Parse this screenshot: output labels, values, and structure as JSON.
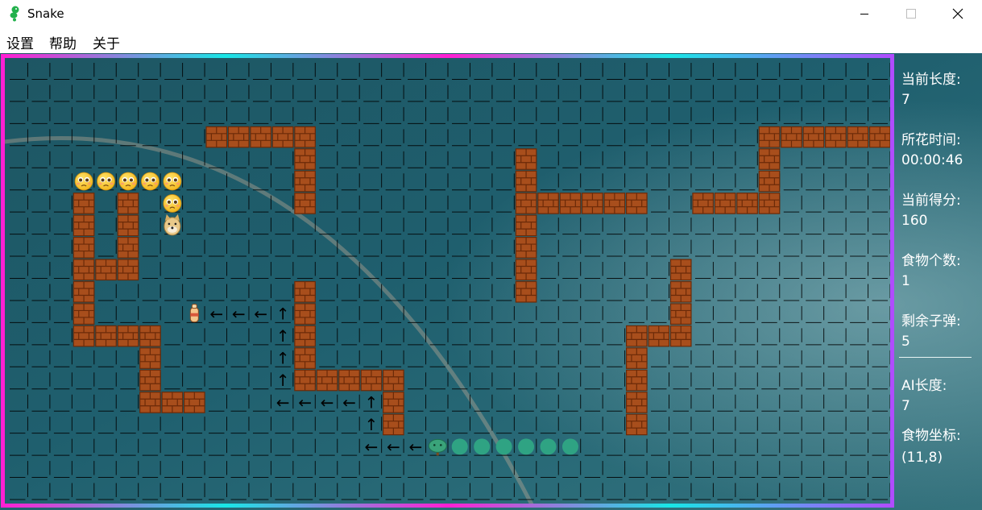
{
  "window": {
    "title": "Snake",
    "icon": "green-snake-icon"
  },
  "menu": {
    "items": [
      "设置",
      "帮助",
      "关于"
    ]
  },
  "panel": {
    "current_length_label": "当前长度:",
    "current_length_value": "7",
    "time_label": "所花时间:",
    "time_value": "00:00:46",
    "score_label": "当前得分:",
    "score_value": "160",
    "food_count_label": "食物个数:",
    "food_count_value": "1",
    "bullets_label": "剩余子弹:",
    "bullets_value": "5",
    "ai_length_label": "AI长度:",
    "ai_length_value": "7",
    "food_coord_label": "食物坐标:",
    "food_coord_value": "(11,8)"
  },
  "board": {
    "columns": 40,
    "rows": 20,
    "walls": [
      [
        9,
        3
      ],
      [
        10,
        3
      ],
      [
        11,
        3
      ],
      [
        12,
        3
      ],
      [
        13,
        3
      ],
      [
        13,
        4
      ],
      [
        13,
        5
      ],
      [
        13,
        6
      ],
      [
        3,
        6
      ],
      [
        3,
        7
      ],
      [
        3,
        8
      ],
      [
        3,
        9
      ],
      [
        3,
        10
      ],
      [
        3,
        11
      ],
      [
        3,
        12
      ],
      [
        5,
        6
      ],
      [
        5,
        7
      ],
      [
        5,
        8
      ],
      [
        5,
        9
      ],
      [
        4,
        9
      ],
      [
        4,
        12
      ],
      [
        5,
        12
      ],
      [
        6,
        12
      ],
      [
        6,
        13
      ],
      [
        6,
        14
      ],
      [
        6,
        15
      ],
      [
        7,
        15
      ],
      [
        8,
        15
      ],
      [
        13,
        10
      ],
      [
        13,
        11
      ],
      [
        13,
        12
      ],
      [
        13,
        13
      ],
      [
        13,
        14
      ],
      [
        14,
        14
      ],
      [
        15,
        14
      ],
      [
        16,
        14
      ],
      [
        17,
        14
      ],
      [
        17,
        15
      ],
      [
        17,
        16
      ],
      [
        23,
        4
      ],
      [
        23,
        5
      ],
      [
        23,
        6
      ],
      [
        23,
        7
      ],
      [
        23,
        8
      ],
      [
        23,
        9
      ],
      [
        23,
        10
      ],
      [
        24,
        6
      ],
      [
        25,
        6
      ],
      [
        26,
        6
      ],
      [
        27,
        6
      ],
      [
        28,
        6
      ],
      [
        31,
        6
      ],
      [
        32,
        6
      ],
      [
        33,
        6
      ],
      [
        34,
        6
      ],
      [
        34,
        3
      ],
      [
        35,
        3
      ],
      [
        36,
        3
      ],
      [
        37,
        3
      ],
      [
        38,
        3
      ],
      [
        39,
        3
      ],
      [
        34,
        4
      ],
      [
        34,
        5
      ],
      [
        30,
        9
      ],
      [
        30,
        10
      ],
      [
        30,
        11
      ],
      [
        30,
        12
      ],
      [
        28,
        12
      ],
      [
        29,
        12
      ],
      [
        28,
        13
      ],
      [
        28,
        14
      ],
      [
        28,
        15
      ],
      [
        28,
        16
      ]
    ],
    "player_snake_icon": "emoji-face-icon",
    "player_head_icon": "doge-head-icon",
    "player_snake": [
      [
        3,
        5
      ],
      [
        4,
        5
      ],
      [
        5,
        5
      ],
      [
        6,
        5
      ],
      [
        7,
        5
      ],
      [
        7,
        6
      ],
      [
        7,
        7
      ]
    ],
    "ai_snake_icon": "tree-head-icon",
    "ai_snake": [
      [
        19,
        17
      ],
      [
        20,
        17
      ],
      [
        21,
        17
      ],
      [
        22,
        17
      ],
      [
        23,
        17
      ],
      [
        24,
        17
      ],
      [
        25,
        17
      ]
    ],
    "food_icon": "bottle-food-icon",
    "food": [
      8,
      11
    ],
    "path_arrows": [
      [
        9,
        11,
        "←"
      ],
      [
        10,
        11,
        "←"
      ],
      [
        11,
        11,
        "←"
      ],
      [
        12,
        11,
        "↑"
      ],
      [
        12,
        12,
        "↑"
      ],
      [
        12,
        13,
        "↑"
      ],
      [
        12,
        14,
        "↑"
      ],
      [
        12,
        15,
        "←"
      ],
      [
        13,
        15,
        "←"
      ],
      [
        14,
        15,
        "←"
      ],
      [
        15,
        15,
        "←"
      ],
      [
        16,
        15,
        "↑"
      ],
      [
        16,
        16,
        "↑"
      ],
      [
        16,
        17,
        "←"
      ],
      [
        17,
        17,
        "←"
      ],
      [
        18,
        17,
        "←"
      ]
    ],
    "colors": {
      "sky": "#1f5c69",
      "sea": "#2c6c7a",
      "wall": "#a84e1c",
      "wall_mortar": "#6b2a08",
      "ai_body": "#2fa383",
      "border_magenta": "#ff1fd3",
      "border_cyan": "#18e6e6",
      "border_purple": "#b04cff",
      "grid_line": "#000000"
    }
  }
}
